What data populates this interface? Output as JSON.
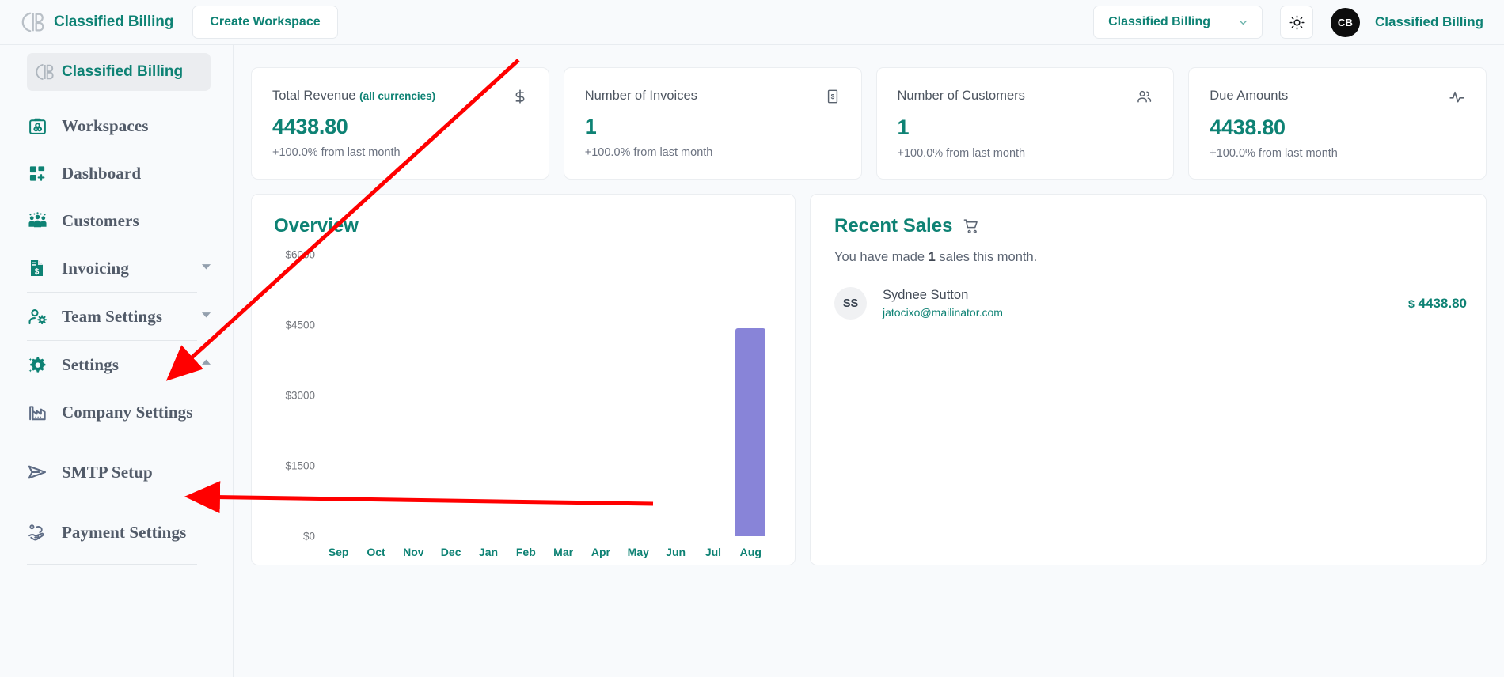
{
  "header": {
    "brand_name": "Classified Billing",
    "create_workspace_label": "Create Workspace",
    "workspace_selected": "Classified Billing",
    "theme_icon": "sun-icon",
    "avatar_initials": "CB",
    "account_name": "Classified Billing"
  },
  "sidebar": {
    "title": "Classified Billing",
    "items": [
      {
        "label": "Workspaces",
        "icon": "workspaces-icon",
        "expandable": false
      },
      {
        "label": "Dashboard",
        "icon": "dashboard-grid-icon",
        "expandable": false
      },
      {
        "label": "Customers",
        "icon": "customers-group-icon",
        "expandable": false
      },
      {
        "label": "Invoicing",
        "icon": "invoice-document-icon",
        "expandable": true,
        "expanded": false
      },
      {
        "label": "Team Settings",
        "icon": "user-gear-icon",
        "expandable": true,
        "expanded": false
      },
      {
        "label": "Settings",
        "icon": "gear-sparkle-icon",
        "expandable": true,
        "expanded": true
      },
      {
        "label": "Company Settings",
        "icon": "factory-icon",
        "expandable": false
      },
      {
        "label": "SMTP Setup",
        "icon": "send-paper-plane-icon",
        "expandable": false
      },
      {
        "label": "Payment Settings",
        "icon": "hand-coin-icon",
        "expandable": false
      }
    ]
  },
  "stats": [
    {
      "title": "Total Revenue",
      "title_note": "(all currencies)",
      "icon": "dollar-sign-icon",
      "value": "4438.80",
      "sub": "+100.0% from last month"
    },
    {
      "title": "Number of Invoices",
      "title_note": "",
      "icon": "banknote-icon",
      "value": "1",
      "sub": "+100.0% from last month"
    },
    {
      "title": "Number of Customers",
      "title_note": "",
      "icon": "users-icon",
      "value": "1",
      "sub": "+100.0% from last month"
    },
    {
      "title": "Due Amounts",
      "title_note": "",
      "icon": "activity-pulse-icon",
      "value": "4438.80",
      "sub": "+100.0% from last month"
    }
  ],
  "overview": {
    "title": "Overview"
  },
  "chart_data": {
    "type": "bar",
    "title": "Overview",
    "categories": [
      "Sep",
      "Oct",
      "Nov",
      "Dec",
      "Jan",
      "Feb",
      "Mar",
      "Apr",
      "May",
      "Jun",
      "Jul",
      "Aug"
    ],
    "values": [
      0,
      0,
      0,
      0,
      0,
      0,
      0,
      0,
      0,
      0,
      0,
      4438.8
    ],
    "ytick_labels": [
      "$6000",
      "$4500",
      "$3000",
      "$1500",
      "$0"
    ],
    "ytick_values": [
      6000,
      4500,
      3000,
      1500,
      0
    ],
    "ylim": [
      0,
      6000
    ],
    "xlabel": "",
    "ylabel": "",
    "grid": false,
    "legend": false,
    "bar_color": "#8884d8"
  },
  "recent_sales": {
    "title": "Recent Sales",
    "icon": "shopping-cart-icon",
    "summary_prefix": "You have made ",
    "summary_count": "1",
    "summary_suffix": " sales this month.",
    "rows": [
      {
        "initials": "SS",
        "name": "Sydnee Sutton",
        "email": "jatocixo@mailinator.com",
        "currency": "$",
        "amount": "4438.80"
      }
    ]
  },
  "annotations": {
    "arrow_1": "red-arrow-pointing-to-settings",
    "arrow_2": "red-arrow-pointing-to-smtp-setup"
  },
  "colors": {
    "accent": "#0e8274",
    "bar": "#8884d8",
    "page_bg": "#f8fafc",
    "annotation": "#ff0000"
  }
}
